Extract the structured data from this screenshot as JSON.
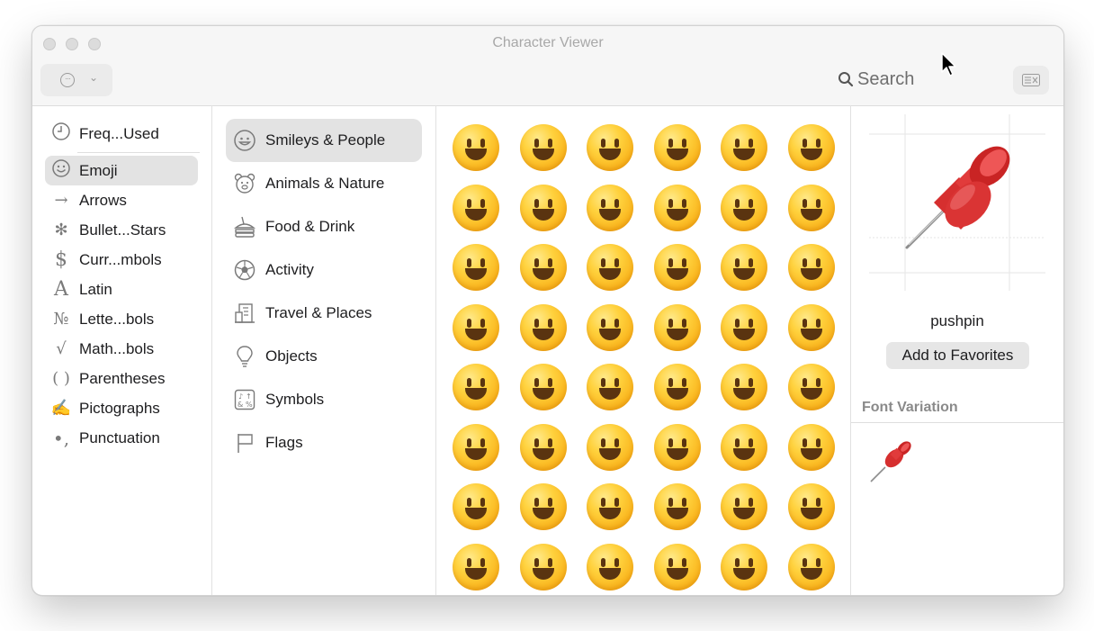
{
  "window": {
    "title": "Character Viewer"
  },
  "toolbar": {
    "search_label": "Search"
  },
  "categories": [
    {
      "label": "Freq...Used",
      "icon": "clock-icon"
    },
    {
      "label": "Emoji",
      "icon": "smiley-icon",
      "selected": true
    },
    {
      "label": "Arrows",
      "icon": "arrow-icon"
    },
    {
      "label": "Bullet...Stars",
      "icon": "asterisk-icon"
    },
    {
      "label": "Curr...mbols",
      "icon": "dollar-icon"
    },
    {
      "label": "Latin",
      "icon": "latin-a-icon"
    },
    {
      "label": "Lette...bols",
      "icon": "numero-icon"
    },
    {
      "label": "Math...bols",
      "icon": "sqrt-icon"
    },
    {
      "label": "Parentheses",
      "icon": "parentheses-icon"
    },
    {
      "label": "Pictographs",
      "icon": "pencil-icon"
    },
    {
      "label": "Punctuation",
      "icon": "punctuation-icon"
    }
  ],
  "subcategories": [
    {
      "label": "Smileys & People",
      "icon": "smiley-icon",
      "selected": true
    },
    {
      "label": "Animals & Nature",
      "icon": "bear-icon"
    },
    {
      "label": "Food & Drink",
      "icon": "burger-icon"
    },
    {
      "label": "Activity",
      "icon": "soccer-ball-icon"
    },
    {
      "label": "Travel & Places",
      "icon": "building-icon"
    },
    {
      "label": "Objects",
      "icon": "lightbulb-icon"
    },
    {
      "label": "Symbols",
      "icon": "symbols-icon"
    },
    {
      "label": "Flags",
      "icon": "flag-icon"
    }
  ],
  "emoji_grid": {
    "columns": 6,
    "rows": 8
  },
  "detail": {
    "character_name": "pushpin",
    "favorites_label": "Add to Favorites",
    "font_variation_label": "Font Variation"
  }
}
